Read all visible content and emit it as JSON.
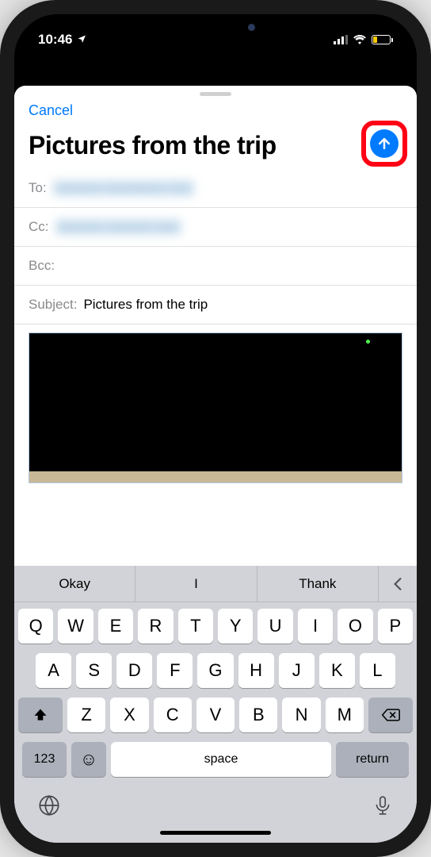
{
  "status": {
    "time": "10:46"
  },
  "nav": {
    "cancel": "Cancel"
  },
  "compose": {
    "title": "Pictures from the trip"
  },
  "fields": {
    "to_label": "To:",
    "to_value": "aaaaaa aaaaaaaa aaa",
    "cc_label": "Cc:",
    "cc_value": "aaaaaa aaaaaa aaa",
    "bcc_label": "Bcc:",
    "bcc_value": "",
    "subject_label": "Subject:",
    "subject_value": "Pictures from the trip"
  },
  "keyboard": {
    "suggestions": [
      "Okay",
      "I",
      "Thank"
    ],
    "row1": [
      "Q",
      "W",
      "E",
      "R",
      "T",
      "Y",
      "U",
      "I",
      "O",
      "P"
    ],
    "row2": [
      "A",
      "S",
      "D",
      "F",
      "G",
      "H",
      "J",
      "K",
      "L"
    ],
    "row3": [
      "Z",
      "X",
      "C",
      "V",
      "B",
      "N",
      "M"
    ],
    "k123": "123",
    "space": "space",
    "return": "return"
  }
}
